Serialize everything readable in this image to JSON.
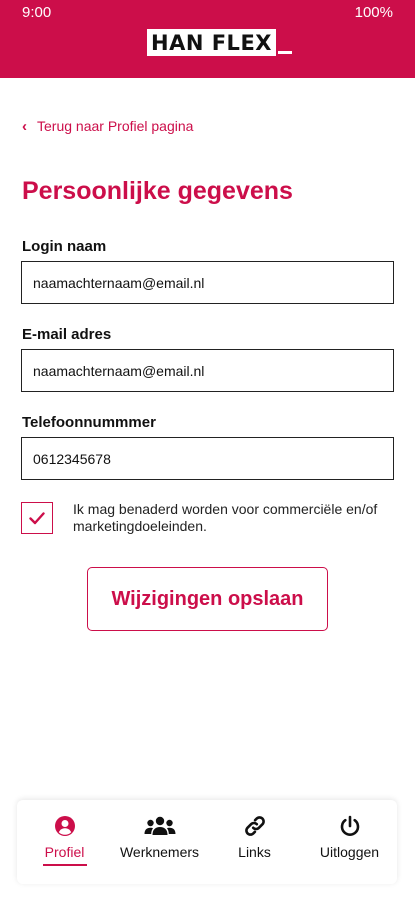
{
  "status_bar": {
    "time": "9:00",
    "battery": "100%"
  },
  "header": {
    "logo_text": "HAN FLEX"
  },
  "back_link": {
    "label": "Terug naar Profiel pagina"
  },
  "page_title": "Persoonlijke gegevens",
  "form": {
    "login": {
      "label": "Login naam",
      "value": "naamachternaam@email.nl"
    },
    "email": {
      "label": "E-mail adres",
      "value": "naamachternaam@email.nl"
    },
    "phone": {
      "label": "Telefoonnummmer",
      "value": "0612345678"
    },
    "consent": {
      "checked": true,
      "text": "Ik mag benaderd worden voor commerciële en/of marketingdoeleinden."
    },
    "save_label": "Wijzigingen opslaan"
  },
  "bottom_nav": {
    "items": [
      {
        "label": "Profiel",
        "icon": "user-circle-icon",
        "active": true
      },
      {
        "label": "Werknemers",
        "icon": "users-icon",
        "active": false
      },
      {
        "label": "Links",
        "icon": "link-icon",
        "active": false
      },
      {
        "label": "Uitloggen",
        "icon": "power-icon",
        "active": false
      }
    ]
  },
  "colors": {
    "brand": "#cc0e4a",
    "text": "#111111",
    "background": "#ffffff"
  }
}
